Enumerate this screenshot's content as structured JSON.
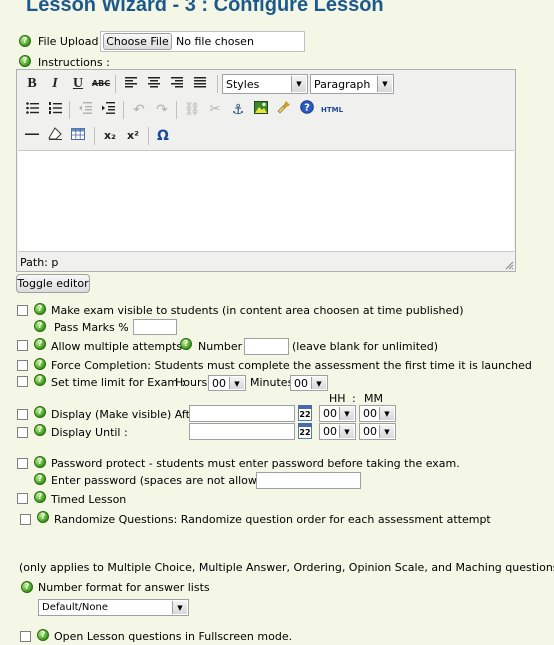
{
  "title": "Lesson Wizard - 3 : Configure Lesson",
  "file_upload": {
    "label": "File Upload :",
    "button": "Choose File",
    "status": "No file chosen"
  },
  "instructions_label": "Instructions :",
  "editor": {
    "styles_select": "Styles",
    "format_select": "Paragraph",
    "html_button": "HTML",
    "path_label": "Path: p",
    "toggle_button": "Toggle editor",
    "icons": {
      "bold": "B",
      "italic": "I",
      "underline": "U",
      "strike": "ABC",
      "subscript": "x₂",
      "superscript": "x²",
      "omega": "Ω"
    }
  },
  "options": {
    "exam_visible": "Make exam visible to students (in content area choosen at time published)",
    "pass_marks": "Pass Marks % :",
    "multiple_attempts": "Allow multiple attempts :",
    "number_label": "Number :",
    "number_hint": "(leave blank for unlimited)",
    "force_completion": "Force Completion: Students must complete the assessment the first time it is launched",
    "time_limit": "Set time limit for Exam :",
    "hours_label": "Hours",
    "hours_value": "00",
    "minutes_label": "Minutes",
    "minutes_value": "00",
    "hh_label": "HH",
    "colon": ":",
    "mm_label": "MM",
    "display_after": "Display (Make visible) After :",
    "display_until": "Display Until :",
    "calendar_day": "22",
    "after_hh": "00",
    "after_mm": "00",
    "until_hh": "00",
    "until_mm": "00",
    "password_protect": "Password protect - students must enter password before taking the exam.",
    "enter_password": "Enter password (spaces are not allowed)",
    "timed_lesson": "Timed Lesson",
    "randomize": "Randomize Questions: Randomize question order for each assessment attempt",
    "applies_note": "(only applies to Multiple Choice, Multiple Answer, Ordering, Opinion Scale, and Maching questions)",
    "number_format": "Number format for answer lists",
    "number_format_value": "Default/None",
    "fullscreen": "Open Lesson questions in Fullscreen mode."
  },
  "colors": {
    "title": "#1c5a8c",
    "background": "#f4f6e6",
    "help_icon": "#3a9a1a"
  }
}
